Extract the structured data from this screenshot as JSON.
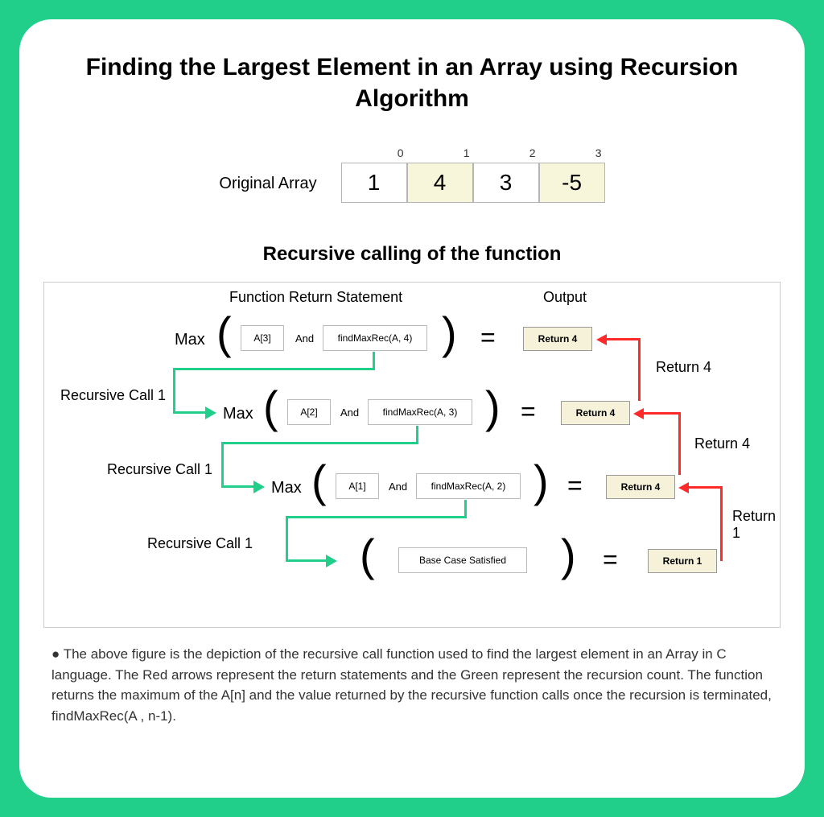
{
  "title": "Finding the Largest Element in an Array using Recursion Algorithm",
  "array_label": "Original Array",
  "array": {
    "indices": [
      "0",
      "1",
      "2",
      "3"
    ],
    "values": [
      "1",
      "4",
      "3",
      "-5"
    ],
    "highlight": [
      false,
      true,
      false,
      true
    ]
  },
  "subtitle": "Recursive calling of the function",
  "headers": {
    "func": "Function Return Statement",
    "out": "Output"
  },
  "rows": [
    {
      "max": "Max",
      "a": "A[3]",
      "and": "And",
      "f": "findMaxRec(A, 4)",
      "eq": "=",
      "ret": "Return 4"
    },
    {
      "max": "Max",
      "a": "A[2]",
      "and": "And",
      "f": "findMaxRec(A, 3)",
      "eq": "=",
      "ret": "Return 4"
    },
    {
      "max": "Max",
      "a": "A[1]",
      "and": "And",
      "f": "findMaxRec(A, 2)",
      "eq": "=",
      "ret": "Return 4"
    },
    {
      "base": "Base Case Satisfied",
      "eq": "=",
      "ret": "Return 1"
    }
  ],
  "rc_labels": {
    "rc1": "Recursive Call 1",
    "rc2": "Recursive Call 1",
    "rc3": "Recursive Call 1"
  },
  "return_labels": {
    "r1": "Return 4",
    "r2": "Return 4",
    "r3": "Return 1"
  },
  "bullet": "The above figure is the depiction of the recursive call function used to find the largest element in an Array in C language. The Red arrows represent the return statements and the Green represent the recursion count. The function returns the maximum of the A[n] and the value returned by the recursive function calls once the recursion is terminated, findMaxRec(A , n-1)."
}
